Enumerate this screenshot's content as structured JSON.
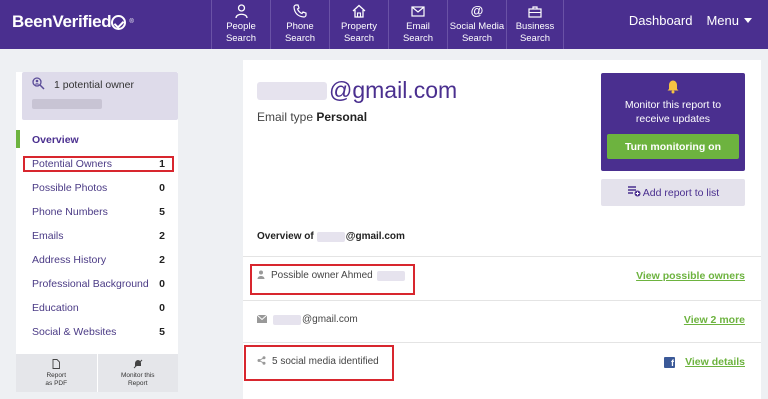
{
  "header": {
    "logo": "BeenVerified",
    "logo_tm": "®",
    "nav": [
      {
        "label": "People\nSearch",
        "icon": "person-icon"
      },
      {
        "label": "Phone\nSearch",
        "icon": "phone-icon"
      },
      {
        "label": "Property\nSearch",
        "icon": "house-icon"
      },
      {
        "label": "Email\nSearch",
        "icon": "envelope-icon"
      },
      {
        "label": "Social Media\nSearch",
        "icon": "at-icon"
      },
      {
        "label": "Business\nSearch",
        "icon": "briefcase-icon"
      }
    ],
    "dashboard": "Dashboard",
    "menu": "Menu"
  },
  "sidebar": {
    "owner_summary": "1 potential owner",
    "items": [
      {
        "label": "Overview",
        "count": ""
      },
      {
        "label": "Potential Owners",
        "count": "1"
      },
      {
        "label": "Possible Photos",
        "count": "0"
      },
      {
        "label": "Phone Numbers",
        "count": "5"
      },
      {
        "label": "Emails",
        "count": "2"
      },
      {
        "label": "Address History",
        "count": "2"
      },
      {
        "label": "Professional Background",
        "count": "0"
      },
      {
        "label": "Education",
        "count": "0"
      },
      {
        "label": "Social & Websites",
        "count": "5"
      }
    ],
    "footer": {
      "report_pdf": "Report\nas PDF",
      "monitor": "Monitor this\nReport"
    }
  },
  "main": {
    "email_domain": "@gmail.com",
    "email_type_label": "Email type",
    "email_type_value": "Personal",
    "monitor": {
      "text": "Monitor this report to receive updates",
      "button": "Turn monitoring on"
    },
    "add_to_list": "Add report to list",
    "overview_prefix": "Overview of",
    "overview_domain": "@gmail.com",
    "rows": [
      {
        "text": "Possible owner Ahmed",
        "link": "View possible owners"
      },
      {
        "text": "@gmail.com",
        "link": "View 2 more"
      },
      {
        "text": "5 social media identified",
        "link": "View details"
      }
    ]
  },
  "colors": {
    "brand_purple": "#4a2f8f",
    "accent_green": "#6db33f",
    "highlight_red": "#d8262e"
  }
}
